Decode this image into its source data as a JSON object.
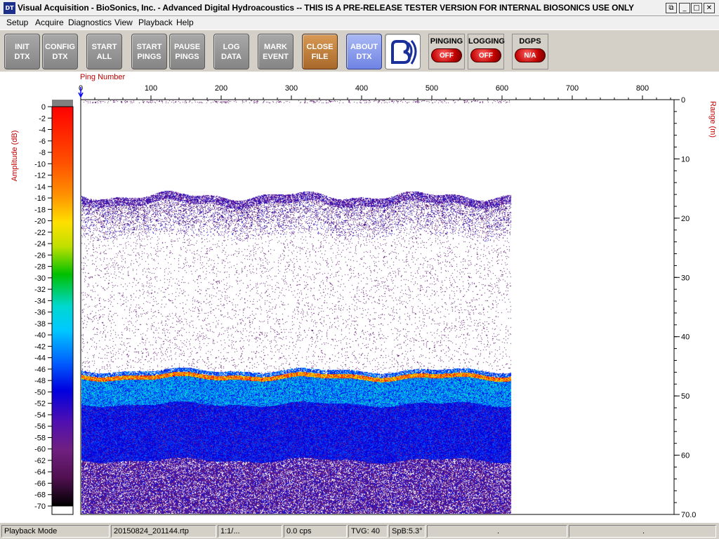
{
  "window": {
    "icon_text": "DT",
    "title": "Visual Acquisition  -  BioSonics, Inc.  -  Advanced Digital Hydroacoustics  -- THIS IS A PRE-RELEASE TESTER VERSION FOR INTERNAL BIOSONICS USE ONLY",
    "restore_glyph": "⧉",
    "minimize_glyph": "_",
    "maximize_glyph": "□",
    "close_glyph": "✕"
  },
  "menu": {
    "items": [
      "Setup",
      "Acquire",
      "Diagnostics",
      "View",
      "Playback",
      "Help"
    ]
  },
  "toolbar": {
    "buttons": [
      {
        "id": "init-dtx",
        "label": "INIT\nDTX"
      },
      {
        "id": "config-dtx",
        "label": "CONFIG\nDTX"
      },
      {
        "id": "start-all",
        "label": "START\nALL"
      },
      {
        "id": "start-pings",
        "label": "START\nPINGS"
      },
      {
        "id": "pause-pings",
        "label": "PAUSE\nPINGS"
      },
      {
        "id": "log-data",
        "label": "LOG\nDATA"
      },
      {
        "id": "mark-event",
        "label": "MARK\nEVENT"
      },
      {
        "id": "close-file",
        "label": "CLOSE\nFILE"
      },
      {
        "id": "about-dtx",
        "label": "ABOUT\nDTX"
      }
    ],
    "status": [
      {
        "id": "pinging",
        "title": "PINGING",
        "state": "OFF"
      },
      {
        "id": "logging",
        "title": "LOGGING",
        "state": "OFF"
      },
      {
        "id": "dgps",
        "title": "DGPS",
        "state": "N/A"
      }
    ]
  },
  "echogram": {
    "x_axis_title": "Ping Number",
    "x_ticks": [
      "0",
      "100",
      "200",
      "300",
      "400",
      "500",
      "600",
      "700",
      "800"
    ],
    "x_range": [
      0,
      845
    ],
    "pings_displayed": 612,
    "y_axis_title": "Range (m)",
    "y_ticks": [
      "0",
      "10",
      "20",
      "30",
      "40",
      "50",
      "60",
      "70.0"
    ],
    "y_range": [
      0,
      70
    ],
    "bottom_depth_m": 46.5,
    "surface_layer_depth_m": 17,
    "colorbar_title": "Amplitude (dB)",
    "colorbar_ticks": [
      "0",
      "-2",
      "-4",
      "-6",
      "-8",
      "-10",
      "-12",
      "-14",
      "-16",
      "-18",
      "-20",
      "-22",
      "-24",
      "-26",
      "-28",
      "-30",
      "-32",
      "-34",
      "-36",
      "-38",
      "-40",
      "-42",
      "-44",
      "-46",
      "-48",
      "-50",
      "-52",
      "-54",
      "-56",
      "-58",
      "-60",
      "-62",
      "-64",
      "-66",
      "-68",
      "-70"
    ],
    "colorbar_range_db": [
      0,
      -70
    ],
    "colors": {
      "axis_title": "#c00000",
      "marker": "#0000ff"
    }
  },
  "statusbar": {
    "mode": "Playback Mode",
    "file": "20150824_201144.rtp",
    "ratio": "1:1/...",
    "rate": "0.0 cps",
    "tvg": "TVG: 40",
    "spb": "SpB:5.3°",
    "dot1": ".",
    "dot2": "."
  }
}
